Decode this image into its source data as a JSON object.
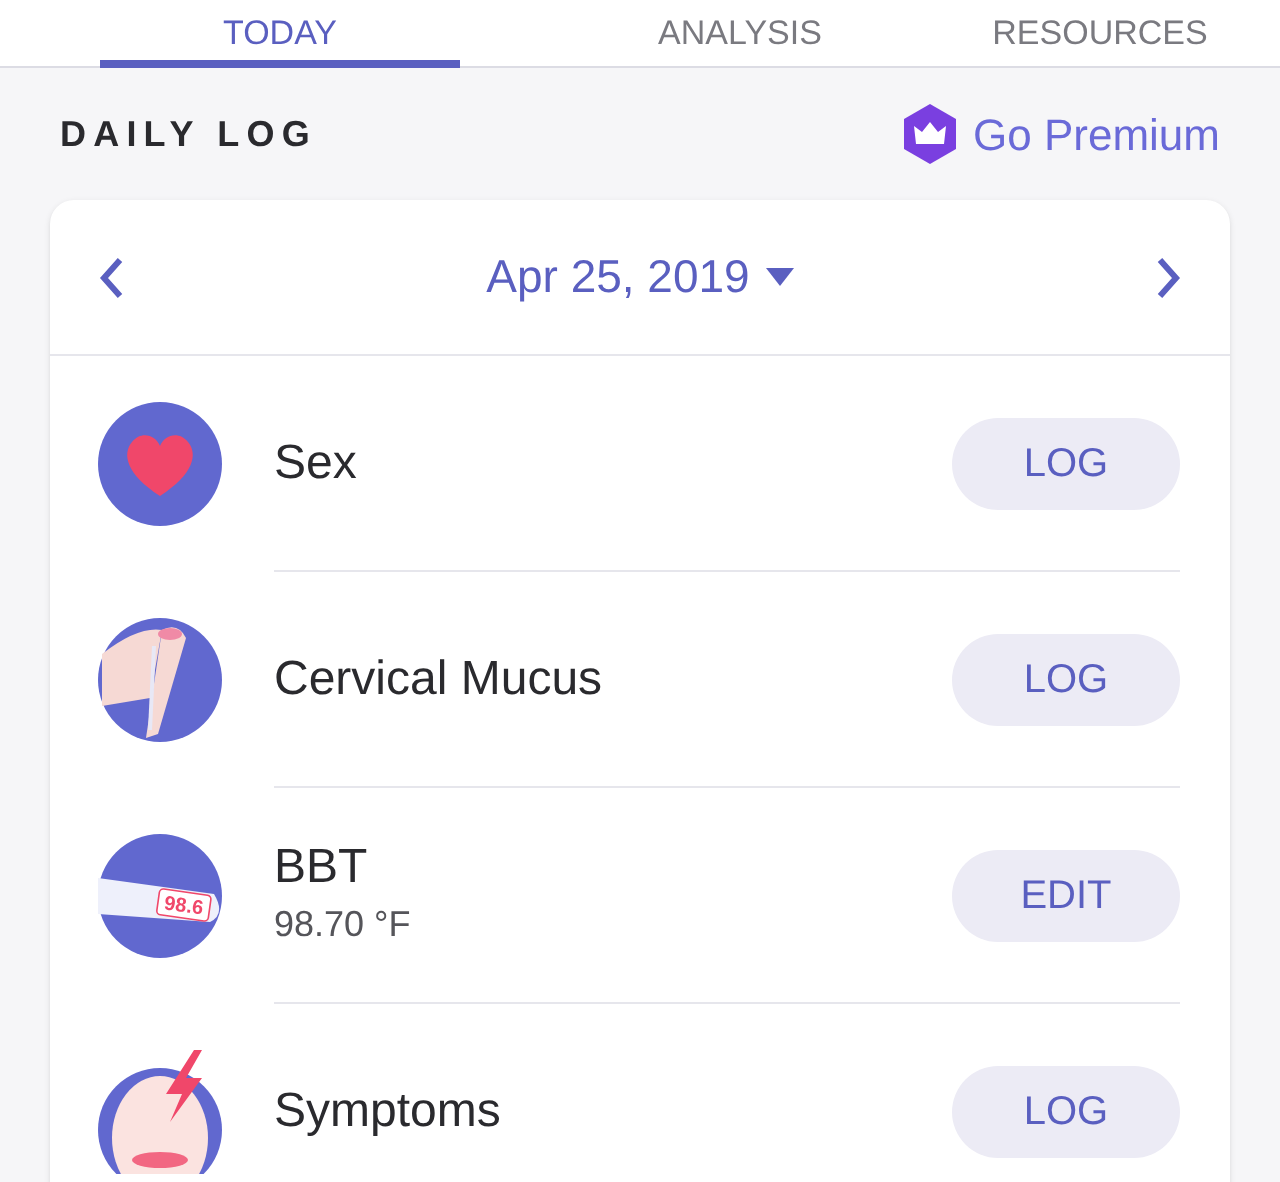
{
  "tabs": [
    {
      "label": "TODAY",
      "selected": true
    },
    {
      "label": "ANALYSIS",
      "selected": false
    },
    {
      "label": "RESOURCES",
      "selected": false
    }
  ],
  "header": {
    "title": "DAILY LOG",
    "premium": "Go Premium"
  },
  "date": {
    "label": "Apr 25, 2019"
  },
  "entries": [
    {
      "kind": "sex",
      "title": "Sex",
      "action": "LOG"
    },
    {
      "kind": "mucus",
      "title": "Cervical Mucus",
      "action": "LOG"
    },
    {
      "kind": "bbt",
      "title": "BBT",
      "value": "98.70 °F",
      "icon_label": "98.6",
      "action": "EDIT"
    },
    {
      "kind": "symptoms",
      "title": "Symptoms",
      "action": "LOG"
    }
  ]
}
